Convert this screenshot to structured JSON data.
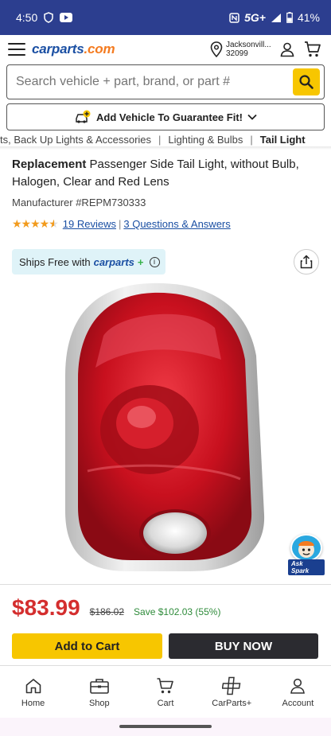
{
  "status_bar": {
    "time": "4:50",
    "network": "5G+",
    "battery": "41%"
  },
  "header": {
    "logo_main": "carparts",
    "logo_suffix": ".com",
    "location_city": "Jacksonvill...",
    "location_zip": "32099"
  },
  "search": {
    "placeholder": "Search vehicle + part, brand, or part #"
  },
  "vehicle_bar": {
    "label": "Add Vehicle To Guarantee Fit!"
  },
  "breadcrumb": {
    "items": [
      "ts, Back Up Lights & Accessories",
      "Lighting & Bulbs",
      "Tail Light"
    ]
  },
  "product": {
    "title_bold": "Replacement",
    "title_rest": " Passenger Side Tail Light, without Bulb, Halogen, Clear and Red Lens",
    "manufacturer": "Manufacturer #REPM730333",
    "rating_stars": 4.5,
    "reviews_label": "19 Reviews",
    "qa_label": "3 Questions & Answers"
  },
  "shipping": {
    "prefix": "Ships Free with ",
    "brand": "carparts",
    "plus": "+"
  },
  "assistant": {
    "label": "Ask Spark"
  },
  "pricing": {
    "price": "$83.99",
    "old_price": "$186.02",
    "save": "Save $102.03 (55%)"
  },
  "buttons": {
    "add_to_cart": "Add to Cart",
    "buy_now": "BUY NOW"
  },
  "bottom_nav": {
    "items": [
      "Home",
      "Shop",
      "Cart",
      "CarParts+",
      "Account"
    ]
  },
  "colors": {
    "status_bar": "#2c3e8f",
    "brand_blue": "#1a4fa3",
    "accent_yellow": "#f7c600",
    "price_red": "#d42e2e",
    "save_green": "#2e8b3a"
  }
}
